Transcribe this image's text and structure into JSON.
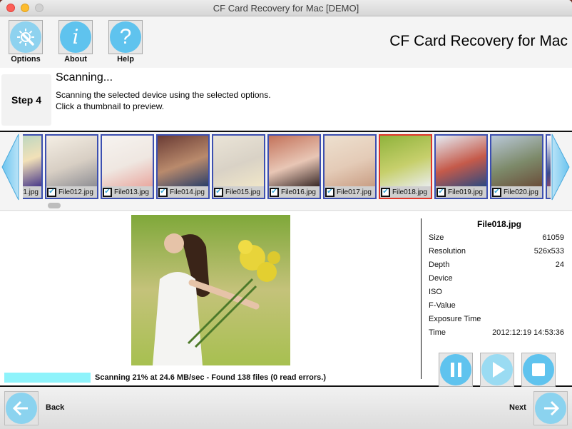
{
  "window": {
    "title": "CF Card Recovery for Mac [DEMO]"
  },
  "toolbar": {
    "options_label": "Options",
    "about_label": "About",
    "help_label": "Help",
    "brand": "CF Card Recovery for Mac",
    "icons": {
      "options": "gear-wrench-icon",
      "about": "info-icon",
      "help": "question-icon"
    }
  },
  "step": {
    "label": "Step 4",
    "title": "Scanning...",
    "description_line1": "Scanning the selected device using the selected options.",
    "description_line2": "Click a thumbnail to preview."
  },
  "thumbnails": [
    {
      "name": "1.jpg",
      "checked": false,
      "partial": true,
      "colors": [
        "#a6d2c4",
        "#f2e1b8",
        "#4a3a8a"
      ]
    },
    {
      "name": "File012.jpg",
      "checked": true,
      "colors": [
        "#f4eee4",
        "#d8cfc4",
        "#8f8f95"
      ]
    },
    {
      "name": "File013.jpg",
      "checked": true,
      "colors": [
        "#f6f3f0",
        "#efe7e1",
        "#e9a8a0"
      ]
    },
    {
      "name": "File014.jpg",
      "checked": true,
      "colors": [
        "#6a3b34",
        "#b98a6c",
        "#2b3f68"
      ]
    },
    {
      "name": "File015.jpg",
      "checked": true,
      "colors": [
        "#eae4d7",
        "#d9d2c6",
        "#f0e6c8"
      ]
    },
    {
      "name": "File016.jpg",
      "checked": true,
      "colors": [
        "#c3725a",
        "#e8c6b5",
        "#3a2a28"
      ]
    },
    {
      "name": "File017.jpg",
      "checked": true,
      "colors": [
        "#ede0cf",
        "#e4cbb7",
        "#c99e84"
      ]
    },
    {
      "name": "File018.jpg",
      "checked": true,
      "selected": true,
      "colors": [
        "#8fb33c",
        "#c6cf6b",
        "#e8ecea"
      ]
    },
    {
      "name": "File019.jpg",
      "checked": true,
      "colors": [
        "#e5ecf4",
        "#c55a4a",
        "#2d4a80"
      ]
    },
    {
      "name": "File020.jpg",
      "checked": true,
      "colors": [
        "#b9c8d8",
        "#7d8a6a",
        "#6b4e3a"
      ]
    },
    {
      "name": "",
      "checked": false,
      "partial": true,
      "colors": [
        "#ffffff",
        "#3a4a8a",
        "#d44"
      ]
    }
  ],
  "preview": {
    "file": "File018.jpg",
    "colors": {
      "bg_top": "#86ad3c",
      "bg_bottom": "#b9c267",
      "dress": "#f4f4f2",
      "hair": "#3a2418",
      "flowers": "#e8d43a"
    }
  },
  "progress": {
    "percent": 21,
    "text": "Scanning 21% at 24.6 MB/sec - Found 138 files (0 read errors.)"
  },
  "info": {
    "filename": "File018.jpg",
    "rows": [
      {
        "key": "Size",
        "value": "61059"
      },
      {
        "key": "Resolution",
        "value": "526x533"
      },
      {
        "key": "Depth",
        "value": "24"
      },
      {
        "key": "Device",
        "value": ""
      },
      {
        "key": "ISO",
        "value": ""
      },
      {
        "key": "F-Value",
        "value": ""
      },
      {
        "key": "Exposure Time",
        "value": ""
      },
      {
        "key": "Time",
        "value": "2012:12:19 14:53:36"
      }
    ]
  },
  "controls": {
    "pause": "pause-icon",
    "play": "play-icon",
    "stop": "stop-icon"
  },
  "footer": {
    "back_label": "Back",
    "next_label": "Next"
  },
  "colors": {
    "accent": "#5fc3ee",
    "thumb_border": "#3c4fb0",
    "selected_border": "#e0362b",
    "progress_fill": "#8ef3fb"
  }
}
